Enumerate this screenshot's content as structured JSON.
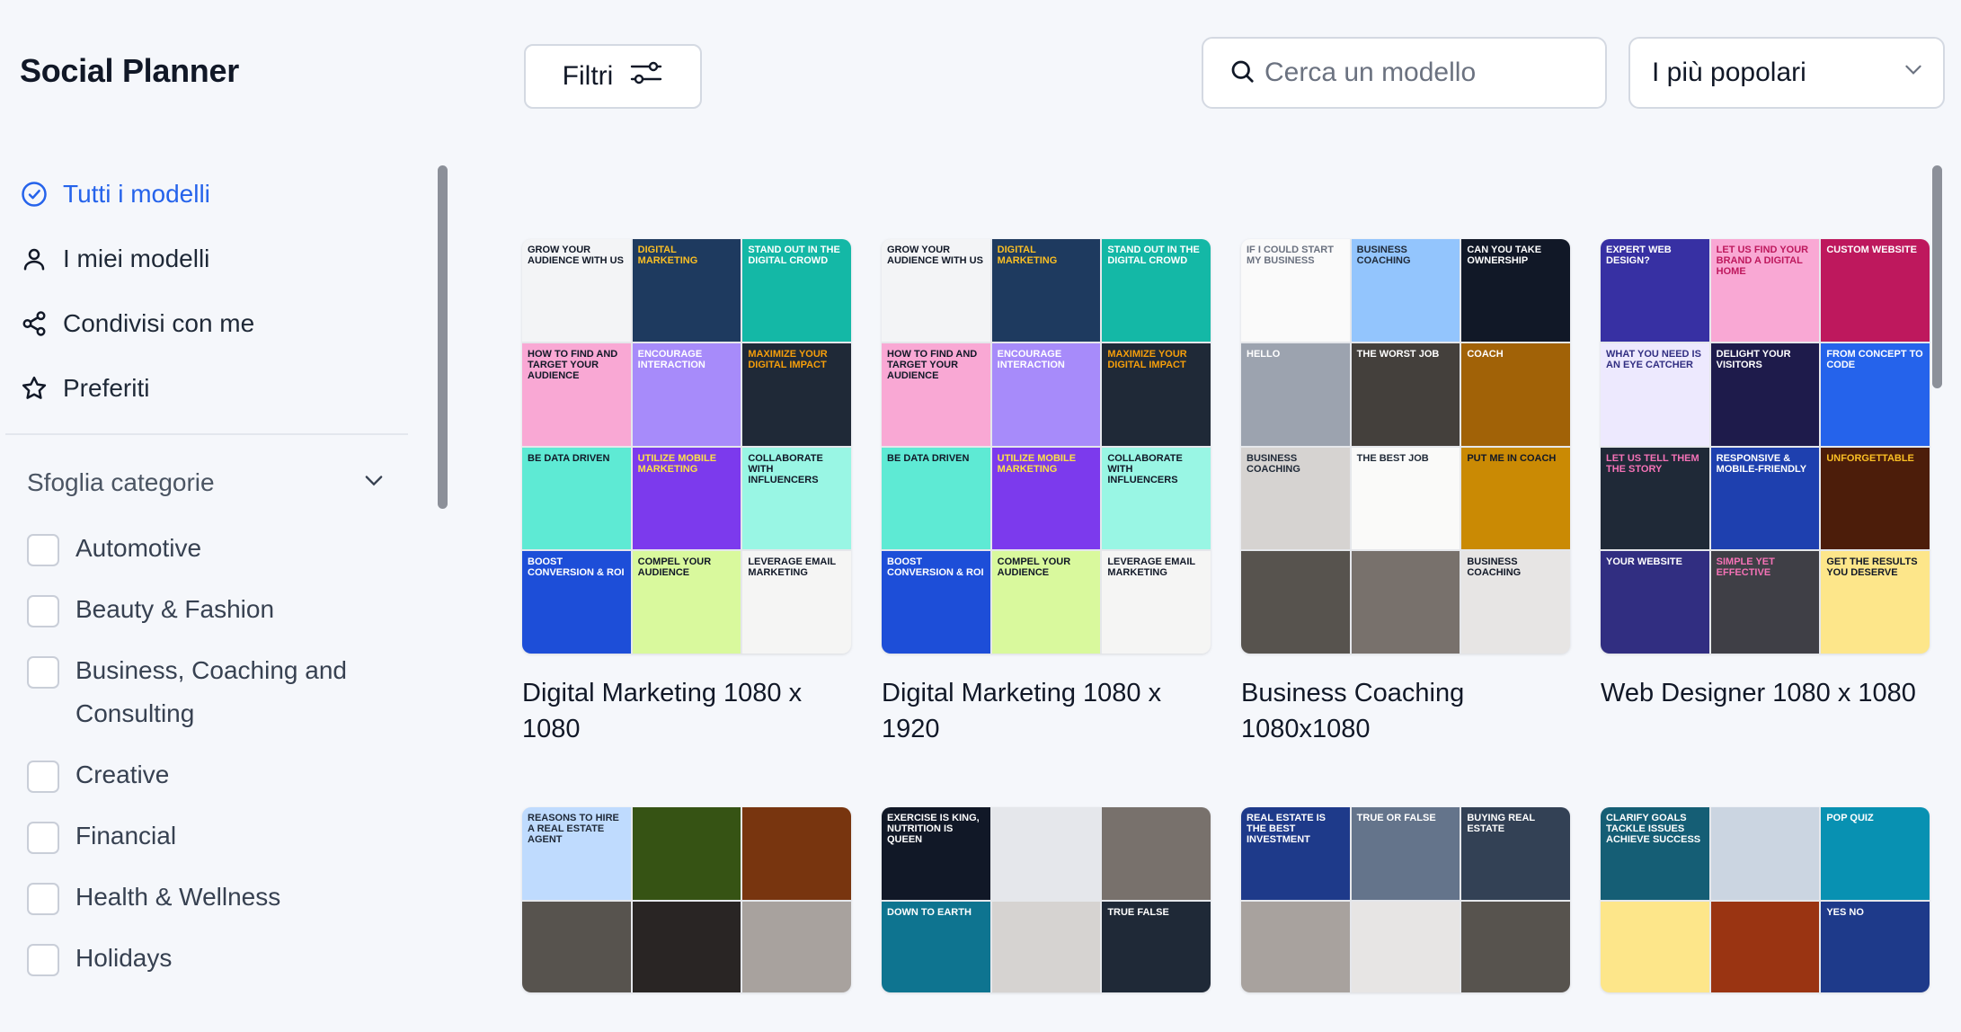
{
  "app": {
    "title": "Social Planner"
  },
  "nav": [
    {
      "label": "Tutti i modelli",
      "icon": "check-circle-icon",
      "active": true
    },
    {
      "label": "I miei modelli",
      "icon": "user-icon",
      "active": false
    },
    {
      "label": "Condivisi con me",
      "icon": "share-icon",
      "active": false
    },
    {
      "label": "Preferiti",
      "icon": "star-icon",
      "active": false
    }
  ],
  "categories": {
    "header": "Sfoglia categorie",
    "items": [
      {
        "label": "Automotive"
      },
      {
        "label": "Beauty & Fashion"
      },
      {
        "label": "Business, Coaching and Consulting"
      },
      {
        "label": "Creative"
      },
      {
        "label": "Financial"
      },
      {
        "label": "Health & Wellness"
      },
      {
        "label": "Holidays"
      }
    ]
  },
  "toolbar": {
    "filter_label": "Filtri",
    "search_placeholder": "Cerca un modello",
    "sort_value": "I più popolari"
  },
  "colors": {
    "accent": "#2563eb",
    "background": "#f5f7fb"
  },
  "templates": [
    {
      "title": "Digital Marketing 1080 x 1080",
      "tiles": [
        {
          "bg": "#f3f4f6",
          "fg": "#111827",
          "text": "Grow Your Audience With us"
        },
        {
          "bg": "#1e3a5f",
          "fg": "#fbbf24",
          "text": "Digital Marketing"
        },
        {
          "bg": "#14b8a6",
          "fg": "#ffffff",
          "text": "Stand out in the digital crowd"
        },
        {
          "bg": "#f9a8d4",
          "fg": "#111827",
          "text": "How to find and target your audience"
        },
        {
          "bg": "#a78bfa",
          "fg": "#ffffff",
          "text": "Encourage interaction"
        },
        {
          "bg": "#1f2937",
          "fg": "#f59e0b",
          "text": "Maximize your digital impact"
        },
        {
          "bg": "#5eead4",
          "fg": "#111827",
          "text": "Be data driven"
        },
        {
          "bg": "#7c3aed",
          "fg": "#fde047",
          "text": "Utilize mobile marketing"
        },
        {
          "bg": "#99f6e4",
          "fg": "#111827",
          "text": "Collaborate with influencers"
        },
        {
          "bg": "#1d4ed8",
          "fg": "#ffffff",
          "text": "Boost conversion & ROI"
        },
        {
          "bg": "#d9f99d",
          "fg": "#111827",
          "text": "Compel your audience"
        },
        {
          "bg": "#f5f5f4",
          "fg": "#111827",
          "text": "Leverage email marketing"
        }
      ]
    },
    {
      "title": "Digital Marketing 1080 x 1920",
      "tiles": [
        {
          "bg": "#f3f4f6",
          "fg": "#111827",
          "text": "Grow Your Audience With us"
        },
        {
          "bg": "#1e3a5f",
          "fg": "#fbbf24",
          "text": "Digital Marketing"
        },
        {
          "bg": "#14b8a6",
          "fg": "#ffffff",
          "text": "Stand out in the digital crowd"
        },
        {
          "bg": "#f9a8d4",
          "fg": "#111827",
          "text": "How to find and target your audience"
        },
        {
          "bg": "#a78bfa",
          "fg": "#ffffff",
          "text": "Encourage interaction"
        },
        {
          "bg": "#1f2937",
          "fg": "#f59e0b",
          "text": "Maximize your digital impact"
        },
        {
          "bg": "#5eead4",
          "fg": "#111827",
          "text": "Be data driven"
        },
        {
          "bg": "#7c3aed",
          "fg": "#fde047",
          "text": "Utilize mobile marketing"
        },
        {
          "bg": "#99f6e4",
          "fg": "#111827",
          "text": "Collaborate with influencers"
        },
        {
          "bg": "#1d4ed8",
          "fg": "#ffffff",
          "text": "Boost conversion & ROI"
        },
        {
          "bg": "#d9f99d",
          "fg": "#111827",
          "text": "Compel your audience"
        },
        {
          "bg": "#f5f5f4",
          "fg": "#111827",
          "text": "Leverage email marketing"
        }
      ]
    },
    {
      "title": "Business Coaching 1080x1080",
      "tiles": [
        {
          "bg": "#fafafa",
          "fg": "#6b7280",
          "text": "If I could start my business"
        },
        {
          "bg": "#93c5fd",
          "fg": "#1f2937",
          "text": "Business coaching"
        },
        {
          "bg": "#111827",
          "fg": "#ffffff",
          "text": "Can you take ownership"
        },
        {
          "bg": "#9ca3af",
          "fg": "#ffffff",
          "text": "Hello"
        },
        {
          "bg": "#44403c",
          "fg": "#ffffff",
          "text": "The worst job"
        },
        {
          "bg": "#a16207",
          "fg": "#ffffff",
          "text": "Coach"
        },
        {
          "bg": "#d6d3d1",
          "fg": "#1f2937",
          "text": "Business coaching"
        },
        {
          "bg": "#fafaf9",
          "fg": "#1f2937",
          "text": "The best job"
        },
        {
          "bg": "#ca8a04",
          "fg": "#111827",
          "text": "Put me in coach"
        },
        {
          "bg": "#57534e",
          "fg": "#ffffff",
          "text": ""
        },
        {
          "bg": "#78716c",
          "fg": "#ffffff",
          "text": ""
        },
        {
          "bg": "#e7e5e4",
          "fg": "#111827",
          "text": "Business coaching"
        }
      ]
    },
    {
      "title": "Web Designer 1080 x 1080",
      "tiles": [
        {
          "bg": "#3730a3",
          "fg": "#ffffff",
          "text": "Expert web design?"
        },
        {
          "bg": "#f9a8d4",
          "fg": "#be185d",
          "text": "Let us find your brand a digital home"
        },
        {
          "bg": "#be185d",
          "fg": "#ffffff",
          "text": "Custom website"
        },
        {
          "bg": "#ede9fe",
          "fg": "#312e81",
          "text": "What you need is an eye catcher"
        },
        {
          "bg": "#1e1b4b",
          "fg": "#ffffff",
          "text": "Delight your visitors"
        },
        {
          "bg": "#2563eb",
          "fg": "#ffffff",
          "text": "From concept to code"
        },
        {
          "bg": "#1f2937",
          "fg": "#f472b6",
          "text": "Let us tell them the story"
        },
        {
          "bg": "#1e40af",
          "fg": "#ffffff",
          "text": "Responsive & mobile-friendly"
        },
        {
          "bg": "#4c1d0a",
          "fg": "#fbbf24",
          "text": "Unforgettable"
        },
        {
          "bg": "#312e81",
          "fg": "#ffffff",
          "text": "Your website"
        },
        {
          "bg": "#3f3f46",
          "fg": "#f472b6",
          "text": "Simple yet effective"
        },
        {
          "bg": "#fde68a",
          "fg": "#111827",
          "text": "Get the results you deserve"
        }
      ]
    },
    {
      "title": "",
      "tiles": [
        {
          "bg": "#bfdbfe",
          "fg": "#1f2937",
          "text": "Reasons to hire a real estate agent"
        },
        {
          "bg": "#365314",
          "fg": "#ffffff",
          "text": ""
        },
        {
          "bg": "#78350f",
          "fg": "#ffffff",
          "text": ""
        },
        {
          "bg": "#57534e",
          "fg": "#ffffff",
          "text": ""
        },
        {
          "bg": "#292524",
          "fg": "#ffffff",
          "text": ""
        },
        {
          "bg": "#a8a29e",
          "fg": "#ffffff",
          "text": ""
        }
      ]
    },
    {
      "title": "",
      "tiles": [
        {
          "bg": "#111827",
          "fg": "#ffffff",
          "text": "Exercise is king, nutrition is queen"
        },
        {
          "bg": "#e5e7eb",
          "fg": "#111827",
          "text": ""
        },
        {
          "bg": "#78716c",
          "fg": "#ffffff",
          "text": ""
        },
        {
          "bg": "#0e7490",
          "fg": "#ffffff",
          "text": "Down to earth"
        },
        {
          "bg": "#d6d3d1",
          "fg": "#111827",
          "text": ""
        },
        {
          "bg": "#1f2937",
          "fg": "#ffffff",
          "text": "True false"
        }
      ]
    },
    {
      "title": "",
      "tiles": [
        {
          "bg": "#1e3a8a",
          "fg": "#ffffff",
          "text": "Real estate is the best investment"
        },
        {
          "bg": "#64748b",
          "fg": "#ffffff",
          "text": "True or false"
        },
        {
          "bg": "#334155",
          "fg": "#ffffff",
          "text": "Buying real estate"
        },
        {
          "bg": "#a8a29e",
          "fg": "#ffffff",
          "text": ""
        },
        {
          "bg": "#e7e5e4",
          "fg": "#111827",
          "text": ""
        },
        {
          "bg": "#57534e",
          "fg": "#ffffff",
          "text": ""
        }
      ]
    },
    {
      "title": "",
      "tiles": [
        {
          "bg": "#155e75",
          "fg": "#ffffff",
          "text": "Clarify goals tackle issues achieve success"
        },
        {
          "bg": "#cbd5e1",
          "fg": "#111827",
          "text": ""
        },
        {
          "bg": "#0891b2",
          "fg": "#ffffff",
          "text": "Pop quiz"
        },
        {
          "bg": "#fde68a",
          "fg": "#111827",
          "text": ""
        },
        {
          "bg": "#9a3412",
          "fg": "#ffffff",
          "text": ""
        },
        {
          "bg": "#1e3a8a",
          "fg": "#ffffff",
          "text": "Yes No"
        }
      ]
    }
  ]
}
